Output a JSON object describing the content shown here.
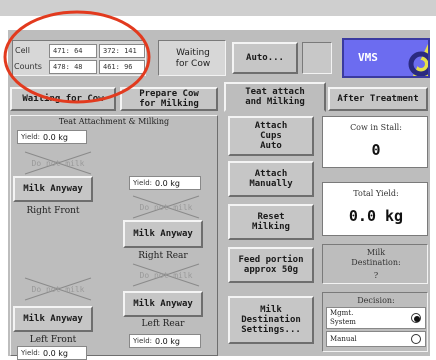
{
  "header": {
    "cell_label": "Cell",
    "counts_label": "Counts",
    "cell_a": "471: 64",
    "cell_b": "372: 141",
    "counts_a": "478: 48",
    "counts_b": "461: 96",
    "status_line1": "Waiting",
    "status_line2": "for Cow",
    "auto_button": "Auto...",
    "logo_text": "VMS",
    "logo_mark": "DL"
  },
  "tabs": [
    {
      "label": "Waiting for Cow"
    },
    {
      "label": "Prepare Cow\nfor Milking"
    },
    {
      "label": "Teat attach\nand Milking"
    },
    {
      "label": "After Treatment"
    }
  ],
  "teat_panel": {
    "title": "Teat Attachment & Milking",
    "top_yield": {
      "label": "Yield:",
      "value": "0.0 kg"
    },
    "ghost_label": "Do not milk",
    "teats": [
      {
        "name": "Right Front",
        "button": "Milk Anyway",
        "yield_label": "Yield:",
        "yield_value": "0.0 kg"
      },
      {
        "name": "Right Rear",
        "button": "Milk Anyway",
        "yield_label": "Yield:",
        "yield_value": "0.0 kg"
      },
      {
        "name": "Left Front",
        "button": "Milk Anyway",
        "yield_label": "Yield:",
        "yield_value": "0.0 kg"
      },
      {
        "name": "Left Rear",
        "button": "Milk Anyway",
        "yield_label": "Yield:",
        "yield_value": "0.0 kg"
      }
    ]
  },
  "actions": {
    "attach_auto": "Attach\nCups\nAuto",
    "attach_manual": "Attach\nManually",
    "reset": "Reset\nMilking",
    "feed": "Feed portion\napprox 50g",
    "destination": "Milk\nDestination\nSettings..."
  },
  "right_panel": {
    "cow_label": "Cow in Stall:",
    "cow_value": "0",
    "yield_label": "Total Yield:",
    "yield_value": "0.0 kg",
    "dest_title": "Milk\nDestination:",
    "dest_value": "?",
    "decision_title": "Decision:",
    "options": [
      {
        "label": "Mgmt.\nSystem",
        "selected": true
      },
      {
        "label": "Manual",
        "selected": false
      }
    ]
  },
  "colors": {
    "logo_blue": "#6c6cf0",
    "logo_yellow": "#e4e04a",
    "annotation_red": "#e23a1e"
  }
}
